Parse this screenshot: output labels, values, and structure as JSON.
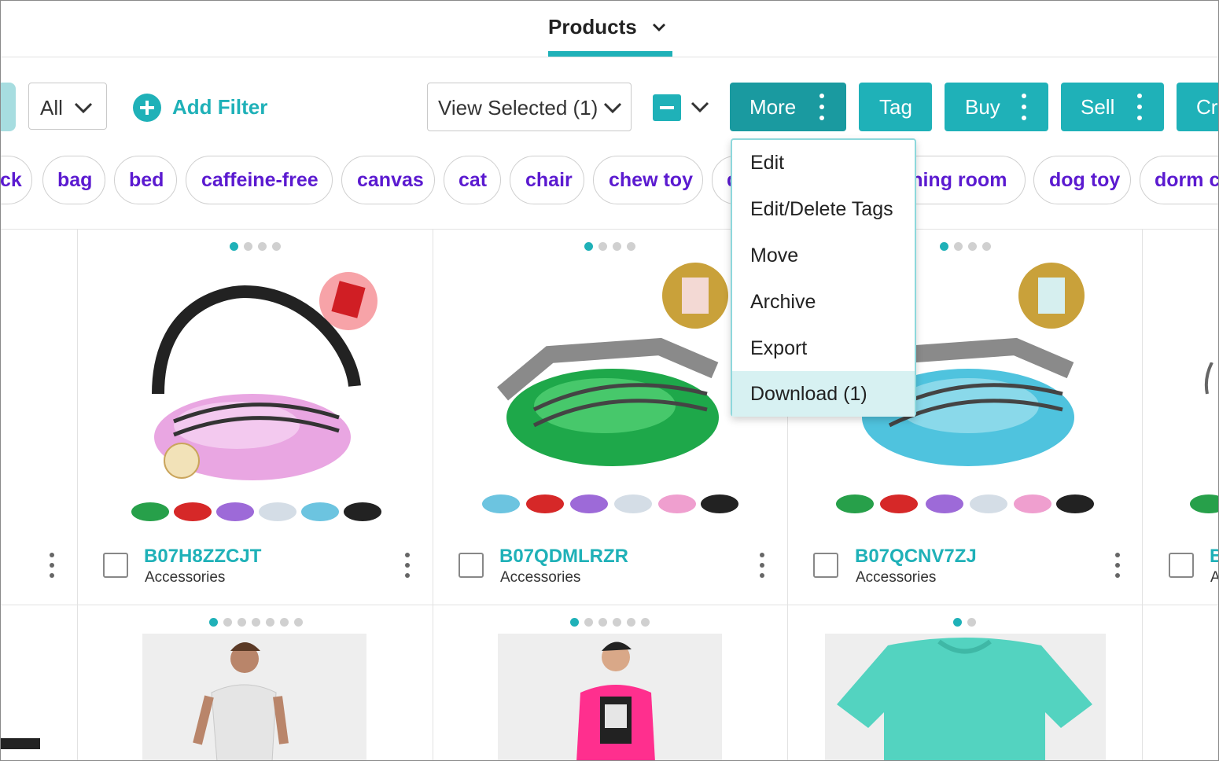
{
  "header": {
    "title": "Products"
  },
  "toolbar": {
    "filter_value": "All",
    "add_filter_label": "Add Filter",
    "view_selected_label": "View Selected (1)",
    "buttons": {
      "more": "More",
      "tag": "Tag",
      "buy": "Buy",
      "sell": "Sell",
      "create": "Cr"
    }
  },
  "tags": [
    "ck",
    "bag",
    "bed",
    "caffeine-free",
    "canvas",
    "cat",
    "chair",
    "chew toy",
    "d",
    "dining room",
    "dog toy",
    "dorm c"
  ],
  "more_menu": {
    "items": [
      "Edit",
      "Edit/Delete Tags",
      "Move",
      "Archive",
      "Export",
      "Download (1)"
    ],
    "highlighted_index": 5
  },
  "products": [
    {
      "sku": "B07H8ZZCJT",
      "category": "Accessories",
      "bag_color": "#e9a6e2",
      "swatches": [
        "#27a04a",
        "#d62828",
        "#9d6ad8",
        "#d4dde6",
        "#6cc4e0",
        "#222222"
      ],
      "badge_color": "#f7a3a8"
    },
    {
      "sku": "B07QDMLRZR",
      "category": "Accessories",
      "bag_color": "#1ea84a",
      "swatches": [
        "#6cc4e0",
        "#d62828",
        "#9d6ad8",
        "#d4dde6",
        "#ef9fcf",
        "#222222"
      ],
      "badge_color": "#c9a13a"
    },
    {
      "sku": "B07QCNV7ZJ",
      "category": "Accessories",
      "bag_color": "#4fc3de",
      "swatches": [
        "#27a04a",
        "#d62828",
        "#9d6ad8",
        "#d4dde6",
        "#ef9fcf",
        "#222222"
      ],
      "badge_color": "#c9a13a"
    },
    {
      "sku": "B",
      "category": "A"
    }
  ],
  "row2": [
    {
      "image": "woman-tank-top",
      "dots": 7
    },
    {
      "image": "man-pink-jacket",
      "dots": 6
    },
    {
      "image": "teal-tshirt",
      "dots": 2
    }
  ],
  "colors": {
    "accent": "#1fb1b8",
    "accent_dark": "#1a9aa0",
    "tag_text": "#5b1ad0",
    "menu_highlight": "#d7f1f2"
  }
}
